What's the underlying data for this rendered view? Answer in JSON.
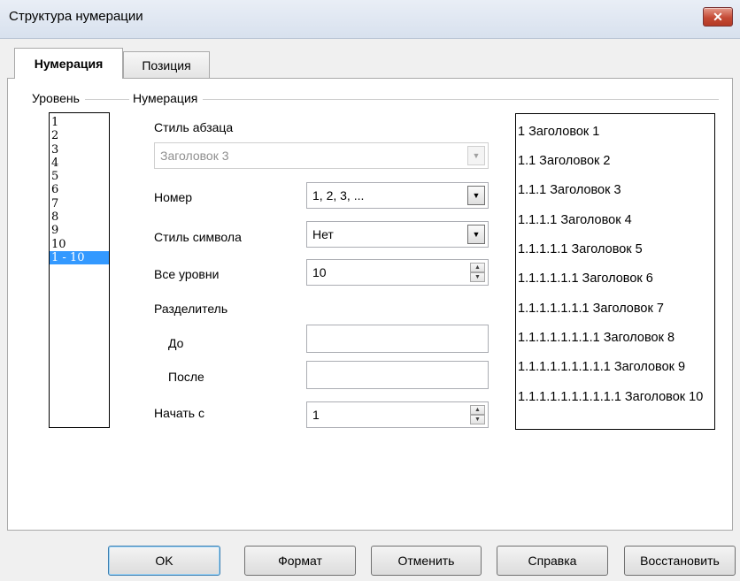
{
  "window": {
    "title": "Структура нумерации"
  },
  "tabs": [
    {
      "label": "Нумерация",
      "active": true
    },
    {
      "label": "Позиция",
      "active": false
    }
  ],
  "level_group": {
    "label": "Уровень",
    "items": [
      "1",
      "2",
      "3",
      "4",
      "5",
      "6",
      "7",
      "8",
      "9",
      "10",
      "1 - 10"
    ],
    "selected": "1 - 10"
  },
  "numbering_group": {
    "label": "Нумерация",
    "paragraph_style_label": "Стиль абзаца",
    "paragraph_style_value": "Заголовок 3",
    "number_label": "Номер",
    "number_value": "1, 2, 3, ...",
    "char_style_label": "Стиль символа",
    "char_style_value": "Нет",
    "all_levels_label": "Все уровни",
    "all_levels_value": "10",
    "separator_label": "Разделитель",
    "before_label": "До",
    "before_value": "",
    "after_label": "После",
    "after_value": "",
    "start_at_label": "Начать с",
    "start_at_value": "1"
  },
  "preview": [
    "1 Заголовок 1",
    "1.1 Заголовок 2",
    "1.1.1 Заголовок 3",
    "1.1.1.1 Заголовок 4",
    "1.1.1.1.1 Заголовок 5",
    "1.1.1.1.1.1 Заголовок 6",
    "1.1.1.1.1.1.1 Заголовок 7",
    "1.1.1.1.1.1.1.1 Заголовок 8",
    "1.1.1.1.1.1.1.1.1 Заголовок 9",
    "1.1.1.1.1.1.1.1.1.1 Заголовок 10"
  ],
  "buttons": {
    "ok": "OK",
    "format": "Формат",
    "cancel": "Отменить",
    "help": "Справка",
    "reset": "Восстановить"
  },
  "icons": {
    "close": "close-icon",
    "dropdown": "chevron-down-icon",
    "spin": "spin-arrows-icon"
  }
}
